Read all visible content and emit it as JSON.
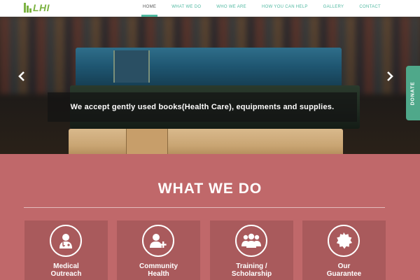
{
  "brand": {
    "logo_text": "LHI"
  },
  "nav": {
    "items": [
      {
        "label": "HOME",
        "active": true
      },
      {
        "label": "WHAT WE DO",
        "active": false
      },
      {
        "label": "WHO WE ARE",
        "active": false
      },
      {
        "label": "HOW YOU CAN HELP",
        "active": false
      },
      {
        "label": "GALLERY",
        "active": false
      },
      {
        "label": "CONTACT",
        "active": false
      }
    ]
  },
  "hero": {
    "caption": "We accept gently used books(Health Care), equipments and supplies.",
    "prev_icon": "chevron-left-icon",
    "next_icon": "chevron-right-icon"
  },
  "donate_tab": {
    "label": "DONATE"
  },
  "what_we_do": {
    "title": "WHAT WE DO",
    "cards": [
      {
        "title_line1": "Medical",
        "title_line2": "Outreach",
        "icon": "doctor-icon"
      },
      {
        "title_line1": "Community",
        "title_line2": "Health",
        "icon": "person-add-icon"
      },
      {
        "title_line1": "Training /",
        "title_line2": "Scholarship",
        "icon": "group-icon"
      },
      {
        "title_line1": "Our",
        "title_line2": "Guarantee",
        "icon": "badge-icon"
      }
    ]
  },
  "colors": {
    "brand_green": "#7cb342",
    "nav_accent": "#4fb8a0",
    "section_bg": "#c0686a",
    "card_bg": "#a95a5c",
    "donate_bg": "#4fa88a"
  }
}
